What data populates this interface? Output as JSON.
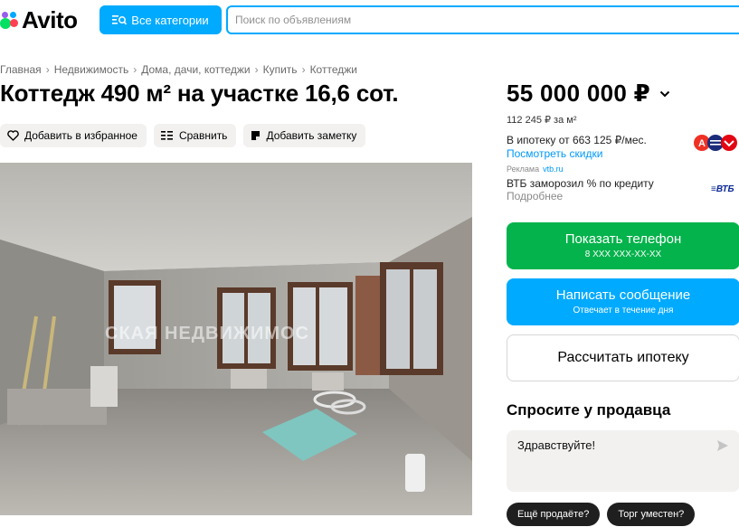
{
  "header": {
    "logo_text": "Avito",
    "categories_label": "Все категории",
    "search_placeholder": "Поиск по объявлениям"
  },
  "breadcrumb": [
    "Главная",
    "Недвижимость",
    "Дома, дачи, коттеджи",
    "Купить",
    "Коттеджи"
  ],
  "listing": {
    "title": "Коттедж 490 м² на участке 16,6 сот.",
    "actions": {
      "favorite": "Добавить в избранное",
      "compare": "Сравнить",
      "note": "Добавить заметку"
    },
    "photo_watermark": "СКАЯ НЕДВИЖИМОС"
  },
  "sidebar": {
    "price": "55 000 000 ₽",
    "price_per_m2": "112 245 ₽ за м²",
    "mortgage_text": "В ипотеку от 663 125 ₽/мес.",
    "discount_link": "Посмотреть скидки",
    "ad_label": "Реклама",
    "ad_domain": "vtb.ru",
    "ad_text": "ВТБ заморозил % по кредиту",
    "ad_more": "Подробнее",
    "ad_logo": "ВТБ",
    "show_phone": "Показать телефон",
    "phone_mask": "8 XXX XXX-XX-XX",
    "write_message": "Написать сообщение",
    "reply_time": "Отвечает в течение дня",
    "calc_mortgage": "Рассчитать ипотеку",
    "ask_title": "Спросите у продавца",
    "ask_value": "Здравствуйте!",
    "chips": [
      "Ещё продаёте?",
      "Торг уместен?"
    ]
  },
  "colors": {
    "accent_blue": "#00aaff",
    "green": "#04b34b",
    "link": "#0099f7"
  }
}
